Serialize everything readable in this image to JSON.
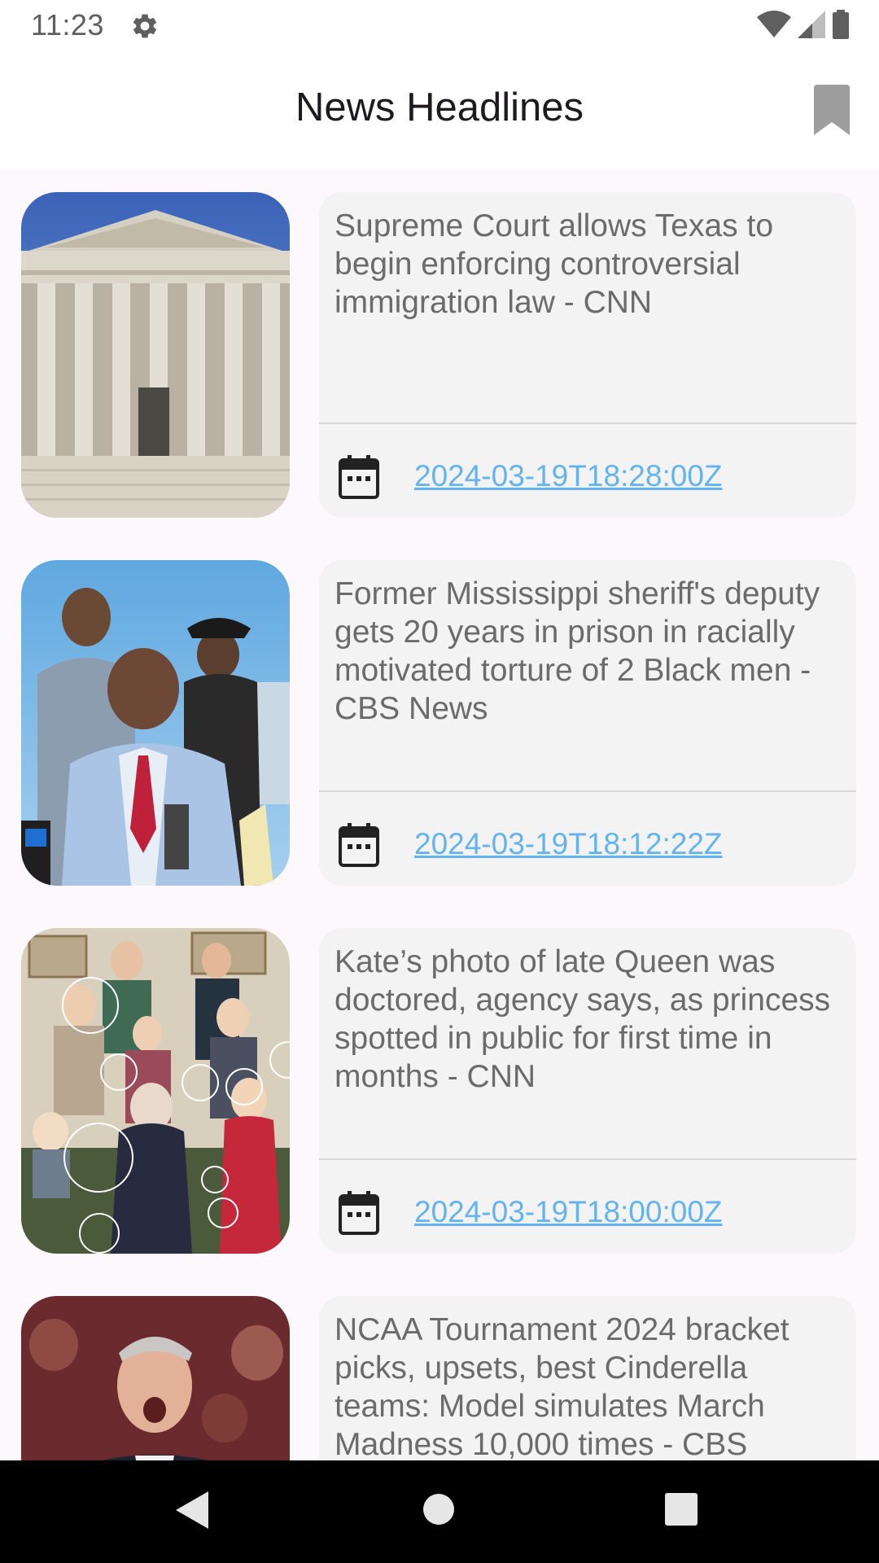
{
  "status_bar": {
    "time": "11:23",
    "icons": [
      "gear-icon",
      "wifi-icon",
      "signal-icon",
      "battery-icon"
    ]
  },
  "app_bar": {
    "title": "News Headlines",
    "bookmark_icon": "bookmark-icon"
  },
  "articles": [
    {
      "title": "Supreme Court allows Texas to begin enforcing controversial immigration law - CNN",
      "date": "2024-03-19T18:28:00Z",
      "image": "supreme-court-building"
    },
    {
      "title": "Former Mississippi sheriff's deputy gets 20 years in prison in racially motivated torture of 2 Black men - CBS News",
      "date": "2024-03-19T18:12:22Z",
      "image": "press-conference"
    },
    {
      "title": "Kate’s photo of late Queen was doctored, agency says, as princess spotted in public for first time in months - CNN",
      "date": "2024-03-19T18:00:00Z",
      "image": "royal-family-photo"
    },
    {
      "title": "NCAA Tournament 2024 bracket picks, upsets, best Cinderella teams: Model simulates March Madness 10,000 times - CBS",
      "date": "",
      "image": "basketball-coach"
    }
  ],
  "colors": {
    "background": "#fdf8fc",
    "card": "#f3f3f3",
    "title_text": "#6b6b6b",
    "date_link": "#63b3f0",
    "nav_bar": "#000000"
  },
  "nav_bar": {
    "buttons": [
      "back-icon",
      "home-icon",
      "recents-icon"
    ]
  }
}
